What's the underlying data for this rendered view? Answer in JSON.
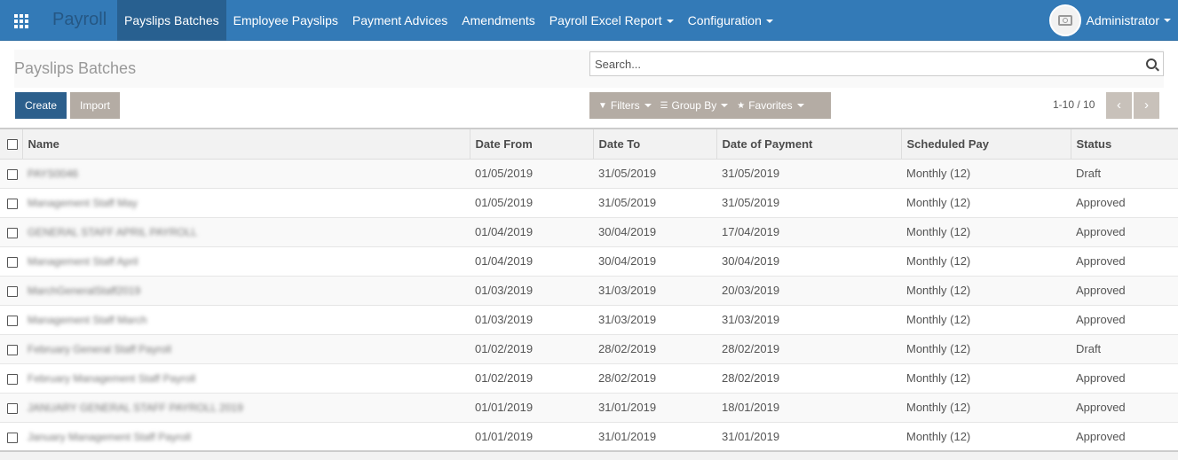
{
  "navbar": {
    "app_name": "Payroll",
    "menu": [
      {
        "label": "Payslips Batches",
        "active": true,
        "dropdown": false
      },
      {
        "label": "Employee Payslips",
        "active": false,
        "dropdown": false
      },
      {
        "label": "Payment Advices",
        "active": false,
        "dropdown": false
      },
      {
        "label": "Amendments",
        "active": false,
        "dropdown": false
      },
      {
        "label": "Payroll Excel Report",
        "active": false,
        "dropdown": true
      },
      {
        "label": "Configuration",
        "active": false,
        "dropdown": true
      }
    ],
    "user": "Administrator",
    "colors": {
      "bar": "#337ab7",
      "active": "#286090"
    }
  },
  "control_panel": {
    "title": "Payslips Batches",
    "search_placeholder": "Search...",
    "create_label": "Create",
    "import_label": "Import",
    "filters_label": "Filters",
    "group_by_label": "Group By",
    "favorites_label": "Favorites",
    "pager": "1-10 / 10"
  },
  "table": {
    "columns": [
      "Name",
      "Date From",
      "Date To",
      "Date of Payment",
      "Scheduled Pay",
      "Status"
    ],
    "rows": [
      {
        "name": "PAYS0046",
        "date_from": "01/05/2019",
        "date_to": "31/05/2019",
        "payment": "31/05/2019",
        "scheduled": "Monthly (12)",
        "status": "Draft"
      },
      {
        "name": "Management Staff May",
        "date_from": "01/05/2019",
        "date_to": "31/05/2019",
        "payment": "31/05/2019",
        "scheduled": "Monthly (12)",
        "status": "Approved"
      },
      {
        "name": "GENERAL STAFF APRIL PAYROLL",
        "date_from": "01/04/2019",
        "date_to": "30/04/2019",
        "payment": "17/04/2019",
        "scheduled": "Monthly (12)",
        "status": "Approved"
      },
      {
        "name": "Management Staff April",
        "date_from": "01/04/2019",
        "date_to": "30/04/2019",
        "payment": "30/04/2019",
        "scheduled": "Monthly (12)",
        "status": "Approved"
      },
      {
        "name": "MarchGeneralStaff2019",
        "date_from": "01/03/2019",
        "date_to": "31/03/2019",
        "payment": "20/03/2019",
        "scheduled": "Monthly (12)",
        "status": "Approved"
      },
      {
        "name": "Management Staff March",
        "date_from": "01/03/2019",
        "date_to": "31/03/2019",
        "payment": "31/03/2019",
        "scheduled": "Monthly (12)",
        "status": "Approved"
      },
      {
        "name": "February General Staff Payroll",
        "date_from": "01/02/2019",
        "date_to": "28/02/2019",
        "payment": "28/02/2019",
        "scheduled": "Monthly (12)",
        "status": "Draft"
      },
      {
        "name": "February Management Staff Payroll",
        "date_from": "01/02/2019",
        "date_to": "28/02/2019",
        "payment": "28/02/2019",
        "scheduled": "Monthly (12)",
        "status": "Approved"
      },
      {
        "name": "JANUARY GENERAL STAFF PAYROLL 2019",
        "date_from": "01/01/2019",
        "date_to": "31/01/2019",
        "payment": "18/01/2019",
        "scheduled": "Monthly (12)",
        "status": "Approved"
      },
      {
        "name": "January Management Staff Payroll",
        "date_from": "01/01/2019",
        "date_to": "31/01/2019",
        "payment": "31/01/2019",
        "scheduled": "Monthly (12)",
        "status": "Approved"
      }
    ]
  }
}
